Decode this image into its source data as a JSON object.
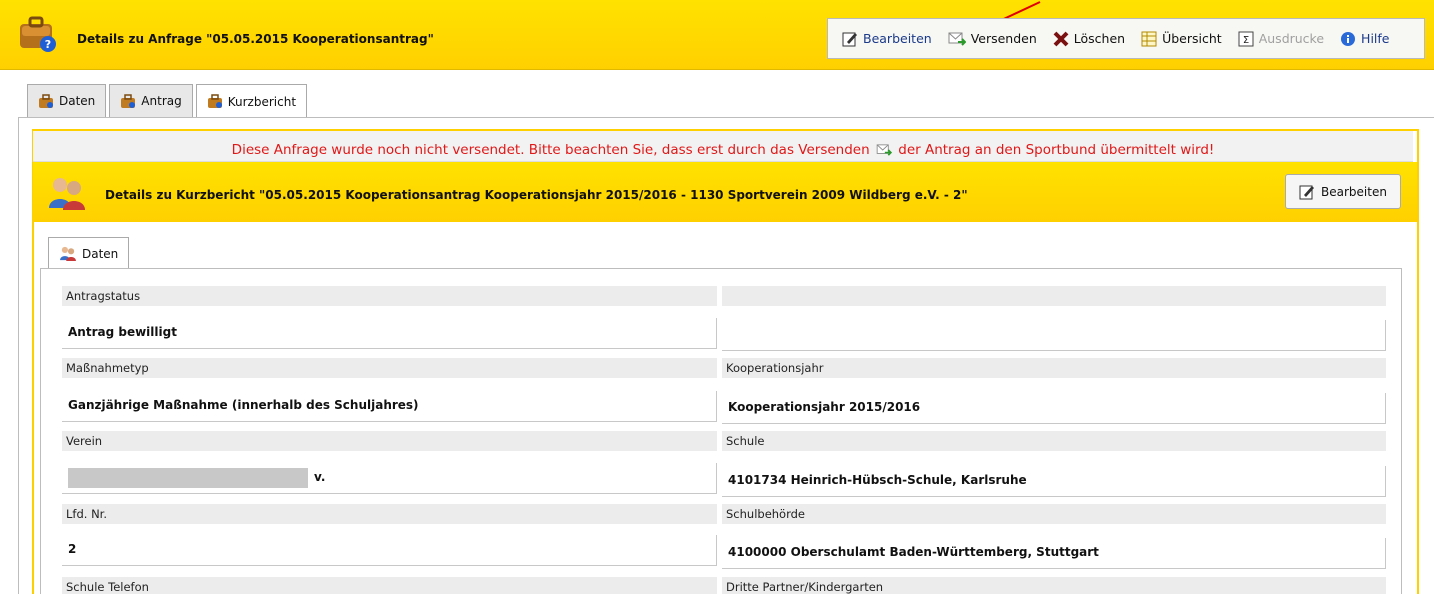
{
  "header": {
    "title": "Details zu  Anfrage \"05.05.2015 Kooperationsantrag\"",
    "icon": "briefcase-help-icon"
  },
  "toolbar": {
    "edit": "Bearbeiten",
    "send": "Versenden",
    "delete": "Löschen",
    "overview": "Übersicht",
    "prints": "Ausdrucke",
    "help": "Hilfe"
  },
  "tabs": [
    "Daten",
    "Antrag",
    "Kurzbericht"
  ],
  "notice": {
    "before": "Diese Anfrage wurde noch nicht versendet. Bitte beachten Sie, dass erst durch das Versenden",
    "after": "der Antrag an den Sportbund übermittelt wird!"
  },
  "detail": {
    "title": "Details zu Kurzbericht \"05.05.2015 Kooperationsantrag Kooperationsjahr 2015/2016 - 1130 Sportverein 2009 Wildberg e.V. - 2\"",
    "edit": "Bearbeiten",
    "tab": "Daten"
  },
  "fields": {
    "antragstatus_label": "Antragstatus",
    "antragstatus_value": "Antrag bewilligt",
    "massnahmetyp_label": "Maßnahmetyp",
    "massnahmetyp_value": "Ganzjährige Maßnahme (innerhalb des Schuljahres)",
    "kooperationsjahr_label": "Kooperationsjahr",
    "kooperationsjahr_value": "Kooperationsjahr 2015/2016",
    "verein_label": "Verein",
    "verein_value_visible": "v.",
    "schule_label": "Schule",
    "schule_value": "4101734 Heinrich-Hübsch-Schule, Karlsruhe",
    "lfdnr_label": "Lfd. Nr.",
    "lfdnr_value": "2",
    "schulbehoerde_label": "Schulbehörde",
    "schulbehoerde_value": "4100000 Oberschulamt Baden-Württemberg, Stuttgart",
    "schule_telefon_label": "Schule Telefon",
    "dritte_partner_label": "Dritte Partner/Kindergarten"
  },
  "colors": {
    "accent_yellow": "#ffd000",
    "notice_red": "#e01818",
    "link_blue": "#1a3a8a"
  }
}
